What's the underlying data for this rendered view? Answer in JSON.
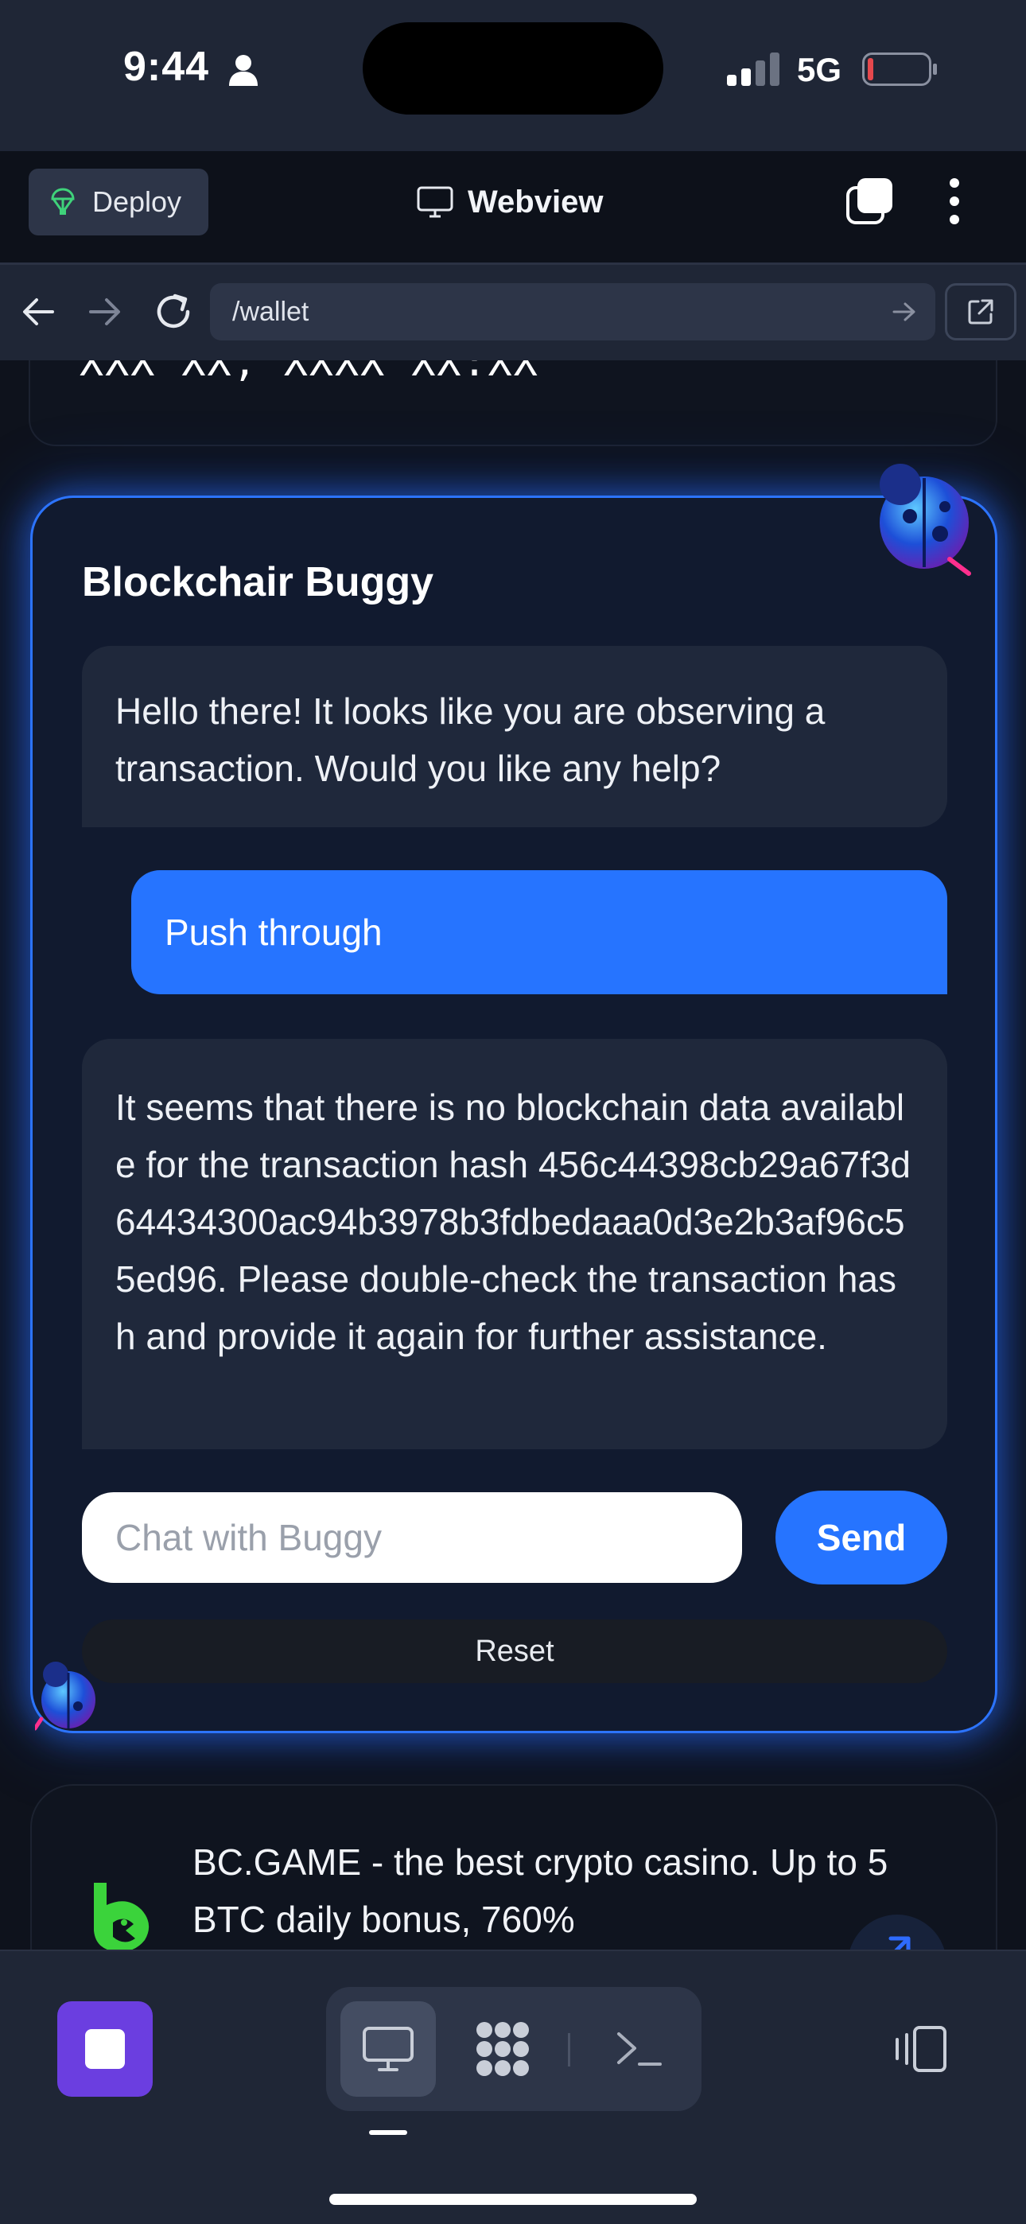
{
  "status_bar": {
    "time": "9:44",
    "network": "5G",
    "icons": [
      "person-icon",
      "signal-icon",
      "battery-icon"
    ]
  },
  "top_bar": {
    "deploy_label": "Deploy",
    "title": "Webview",
    "icons": [
      "deploy-icon",
      "monitor-icon",
      "tabs-icon",
      "more-icon"
    ]
  },
  "address_bar": {
    "url": "/wallet",
    "icons": [
      "back-arrow-icon",
      "forward-arrow-icon",
      "reload-icon",
      "go-arrow-icon",
      "open-external-icon"
    ]
  },
  "page": {
    "masked_value": "XXX XX, XXXX XX:XX",
    "chat": {
      "title": "Blockchair Buggy",
      "messages": [
        {
          "role": "bot",
          "text": "Hello there! It looks like you are observing a transaction. Would you like any help?"
        },
        {
          "role": "user",
          "text": "Push through"
        },
        {
          "role": "bot",
          "text": "It seems that there is no blockchain data available for the transaction hash 456c44398cb29a67f3d64434300ac94b3978b3fdbedaaa0d3e2b3af96c55ed96. Please double-check the transaction hash and provide it again for further assistance."
        }
      ],
      "input_placeholder": "Chat with Buggy",
      "send_label": "Send",
      "reset_label": "Reset"
    },
    "ad": {
      "text": "BC.GAME - the best crypto casino. Up to 5 BTC daily bonus, 760%",
      "logo_color": "#3bd33b"
    }
  },
  "bottom_bar": {
    "icons": [
      "stop-icon",
      "desktop-icon",
      "apps-icon",
      "console-icon",
      "device-icon"
    ]
  },
  "colors": {
    "accent_blue": "#2674ff",
    "stop_purple": "#6b3ee0",
    "battery_low": "#e5484d"
  }
}
